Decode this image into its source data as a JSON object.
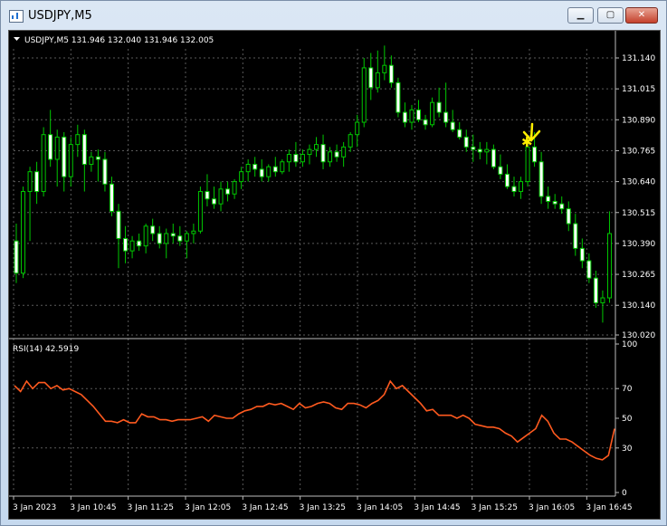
{
  "window": {
    "title": "USDJPY,M5",
    "minimize_glyph": "▁",
    "maximize_glyph": "▢",
    "close_glyph": "✕"
  },
  "chart": {
    "header": "USDJPY,M5  131.946 132.040 131.946 132.005",
    "bull_color": "#00c800",
    "bear_fill": "#ffffff",
    "grid_color": "#5a5a5a",
    "rsi_color": "#ff5a1f",
    "arrow_color": "#ffee00"
  },
  "rsi": {
    "label": "RSI(14) 42.5919"
  },
  "chart_data": [
    {
      "type": "candlestick",
      "y_ticks": [
        "131.140",
        "131.015",
        "130.890",
        "130.765",
        "130.640",
        "130.515",
        "130.390",
        "130.265",
        "130.140",
        "130.020"
      ],
      "ylim": [
        130.02,
        131.14
      ],
      "x_ticks": [
        "3 Jan 2023",
        "3 Jan 10:45",
        "3 Jan 11:25",
        "3 Jan 12:05",
        "3 Jan 12:45",
        "3 Jan 13:25",
        "3 Jan 14:05",
        "3 Jan 14:45",
        "3 Jan 15:25",
        "3 Jan 16:05",
        "3 Jan 16:45"
      ],
      "ohlc": [
        [
          130.4,
          130.47,
          130.23,
          130.27
        ],
        [
          130.27,
          130.62,
          130.25,
          130.6
        ],
        [
          130.6,
          130.7,
          130.4,
          130.68
        ],
        [
          130.68,
          130.72,
          130.55,
          130.6
        ],
        [
          130.6,
          130.86,
          130.58,
          130.83
        ],
        [
          130.83,
          130.93,
          130.7,
          130.73
        ],
        [
          130.73,
          130.85,
          130.62,
          130.82
        ],
        [
          130.82,
          130.84,
          130.6,
          130.66
        ],
        [
          130.66,
          130.82,
          130.62,
          130.79
        ],
        [
          130.79,
          130.87,
          130.74,
          130.83
        ],
        [
          130.83,
          130.85,
          130.6,
          130.71
        ],
        [
          130.71,
          130.76,
          130.68,
          130.74
        ],
        [
          130.74,
          130.77,
          130.64,
          130.73
        ],
        [
          130.73,
          130.76,
          130.6,
          130.63
        ],
        [
          130.63,
          130.66,
          130.5,
          130.52
        ],
        [
          130.52,
          130.55,
          130.29,
          130.41
        ],
        [
          130.41,
          130.46,
          130.31,
          130.36
        ],
        [
          130.36,
          130.42,
          130.33,
          130.4
        ],
        [
          130.4,
          130.43,
          130.36,
          130.38
        ],
        [
          130.38,
          130.47,
          130.35,
          130.46
        ],
        [
          130.46,
          130.49,
          130.4,
          130.43
        ],
        [
          130.43,
          130.46,
          130.37,
          130.39
        ],
        [
          130.39,
          130.45,
          130.33,
          130.43
        ],
        [
          130.43,
          130.47,
          130.39,
          130.42
        ],
        [
          130.42,
          130.46,
          130.38,
          130.4
        ],
        [
          130.4,
          130.44,
          130.33,
          130.43
        ],
        [
          130.43,
          130.47,
          130.39,
          130.44
        ],
        [
          130.44,
          130.62,
          130.43,
          130.6
        ],
        [
          130.6,
          130.67,
          130.54,
          130.57
        ],
        [
          130.57,
          130.62,
          130.53,
          130.55
        ],
        [
          130.55,
          130.64,
          130.52,
          130.61
        ],
        [
          130.61,
          130.64,
          130.56,
          130.59
        ],
        [
          130.59,
          130.65,
          130.57,
          130.64
        ],
        [
          130.64,
          130.7,
          130.61,
          130.68
        ],
        [
          130.68,
          130.73,
          130.64,
          130.71
        ],
        [
          130.71,
          130.74,
          130.66,
          130.69
        ],
        [
          130.69,
          130.73,
          130.64,
          130.66
        ],
        [
          130.66,
          130.71,
          130.64,
          130.7
        ],
        [
          130.7,
          130.74,
          130.66,
          130.68
        ],
        [
          130.68,
          130.73,
          130.67,
          130.72
        ],
        [
          130.72,
          130.77,
          130.68,
          130.75
        ],
        [
          130.75,
          130.8,
          130.7,
          130.72
        ],
        [
          130.72,
          130.77,
          130.7,
          130.75
        ],
        [
          130.75,
          130.79,
          130.71,
          130.77
        ],
        [
          130.77,
          130.82,
          130.74,
          130.79
        ],
        [
          130.79,
          130.83,
          130.69,
          130.72
        ],
        [
          130.72,
          130.78,
          130.7,
          130.76
        ],
        [
          130.76,
          130.79,
          130.72,
          130.74
        ],
        [
          130.74,
          130.8,
          130.7,
          130.78
        ],
        [
          130.78,
          130.84,
          130.76,
          130.83
        ],
        [
          130.83,
          130.91,
          130.78,
          130.88
        ],
        [
          130.88,
          131.14,
          130.86,
          131.1
        ],
        [
          131.1,
          131.16,
          130.97,
          131.02
        ],
        [
          131.02,
          131.17,
          131.0,
          131.08
        ],
        [
          131.08,
          131.19,
          131.05,
          131.11
        ],
        [
          131.11,
          131.15,
          131.02,
          131.04
        ],
        [
          131.04,
          131.06,
          130.9,
          130.92
        ],
        [
          130.92,
          130.96,
          130.86,
          130.88
        ],
        [
          130.88,
          130.95,
          130.85,
          130.93
        ],
        [
          130.93,
          130.97,
          130.88,
          130.89
        ],
        [
          130.89,
          130.91,
          130.85,
          130.87
        ],
        [
          130.87,
          130.98,
          130.86,
          130.96
        ],
        [
          130.96,
          131.02,
          130.9,
          130.92
        ],
        [
          130.92,
          131.04,
          130.86,
          130.88
        ],
        [
          130.88,
          130.93,
          130.84,
          130.85
        ],
        [
          130.85,
          130.88,
          130.81,
          130.82
        ],
        [
          130.82,
          130.85,
          130.76,
          130.78
        ],
        [
          130.78,
          130.83,
          130.72,
          130.77
        ],
        [
          130.77,
          130.8,
          130.73,
          130.76
        ],
        [
          130.76,
          130.8,
          130.71,
          130.77
        ],
        [
          130.77,
          130.79,
          130.69,
          130.7
        ],
        [
          130.7,
          130.75,
          130.65,
          130.67
        ],
        [
          130.67,
          130.71,
          130.61,
          130.62
        ],
        [
          130.62,
          130.66,
          130.58,
          130.6
        ],
        [
          130.6,
          130.66,
          130.57,
          130.64
        ],
        [
          130.64,
          130.8,
          130.62,
          130.78
        ],
        [
          130.78,
          130.84,
          130.7,
          130.72
        ],
        [
          130.72,
          130.76,
          130.55,
          130.58
        ],
        [
          130.58,
          130.62,
          130.53,
          130.56
        ],
        [
          130.56,
          130.59,
          130.53,
          130.55
        ],
        [
          130.55,
          130.58,
          130.51,
          130.53
        ],
        [
          130.53,
          130.56,
          130.44,
          130.47
        ],
        [
          130.47,
          130.51,
          130.34,
          130.37
        ],
        [
          130.37,
          130.41,
          130.29,
          130.32
        ],
        [
          130.32,
          130.35,
          130.23,
          130.25
        ],
        [
          130.25,
          130.28,
          130.13,
          130.15
        ],
        [
          130.15,
          130.2,
          130.07,
          130.17
        ],
        [
          130.17,
          130.52,
          130.15,
          130.43
        ]
      ]
    },
    {
      "type": "line",
      "title": "RSI(14) 42.5919",
      "y_ticks": [
        "100",
        "70",
        "50",
        "30",
        "0"
      ],
      "ylim": [
        0,
        100
      ],
      "values": [
        72,
        68,
        75,
        70,
        74,
        74,
        70,
        72,
        69,
        70,
        68,
        66,
        62,
        58,
        53,
        48,
        48,
        47,
        49,
        47,
        47,
        53,
        51,
        51,
        49,
        49,
        48,
        49,
        49,
        49,
        50,
        51,
        48,
        52,
        51,
        50,
        50,
        53,
        55,
        56,
        58,
        58,
        60,
        59,
        60,
        58,
        56,
        60,
        57,
        58,
        60,
        61,
        60,
        57,
        56,
        60,
        60,
        59,
        57,
        60,
        62,
        66,
        75,
        70,
        72,
        68,
        64,
        60,
        55,
        56,
        52,
        52,
        52,
        50,
        52,
        50,
        46,
        45,
        44,
        44,
        43,
        40,
        38,
        34,
        37,
        40,
        43,
        52,
        48,
        40,
        36,
        36,
        34,
        31,
        28,
        25,
        23,
        22,
        25,
        43
      ]
    }
  ]
}
